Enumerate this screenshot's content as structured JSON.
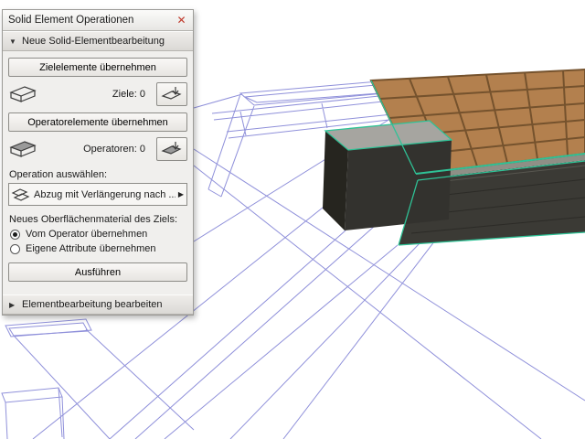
{
  "window": {
    "title": "Solid Element Operationen",
    "close_glyph": "✕"
  },
  "sections": {
    "new": {
      "collapse_glyph": "▼",
      "label": "Neue Solid-Elementbearbeitung"
    },
    "edit": {
      "collapse_glyph": "▶",
      "label": "Elementbearbeitung bearbeiten"
    }
  },
  "controls": {
    "take_targets_button": "Zielelemente übernehmen",
    "targets_count_label": "Ziele: 0",
    "take_operators_button": "Operatorelemente übernehmen",
    "operators_count_label": "Operatoren: 0",
    "operation_select_label": "Operation auswählen:",
    "operation_dropdown_value": "Abzug mit Verlängerung nach ...",
    "dropdown_arrow_glyph": "▶",
    "material_label": "Neues Oberflächenmaterial des Ziels:",
    "radios": [
      {
        "label": "Vom Operator übernehmen",
        "selected": true
      },
      {
        "label": "Eigene Attribute übernehmen",
        "selected": false
      }
    ],
    "execute_button": "Ausführen"
  },
  "viewport": {
    "description": "3D-Fenster mit Drahtmodell und ausgewählter Deck-Platte mit Stufe",
    "colors": {
      "background": "#ffffff",
      "wireframe": "#8f90da",
      "selection_highlight": "#2fc296",
      "tile_surface": "#b3804e",
      "tile_grid": "#75522d",
      "fascia": "#3b3a35",
      "slab_edge": "#8f8f86",
      "step_top": "#a6a5a0",
      "step_front": "#33322e",
      "step_side": "#26251f"
    }
  }
}
